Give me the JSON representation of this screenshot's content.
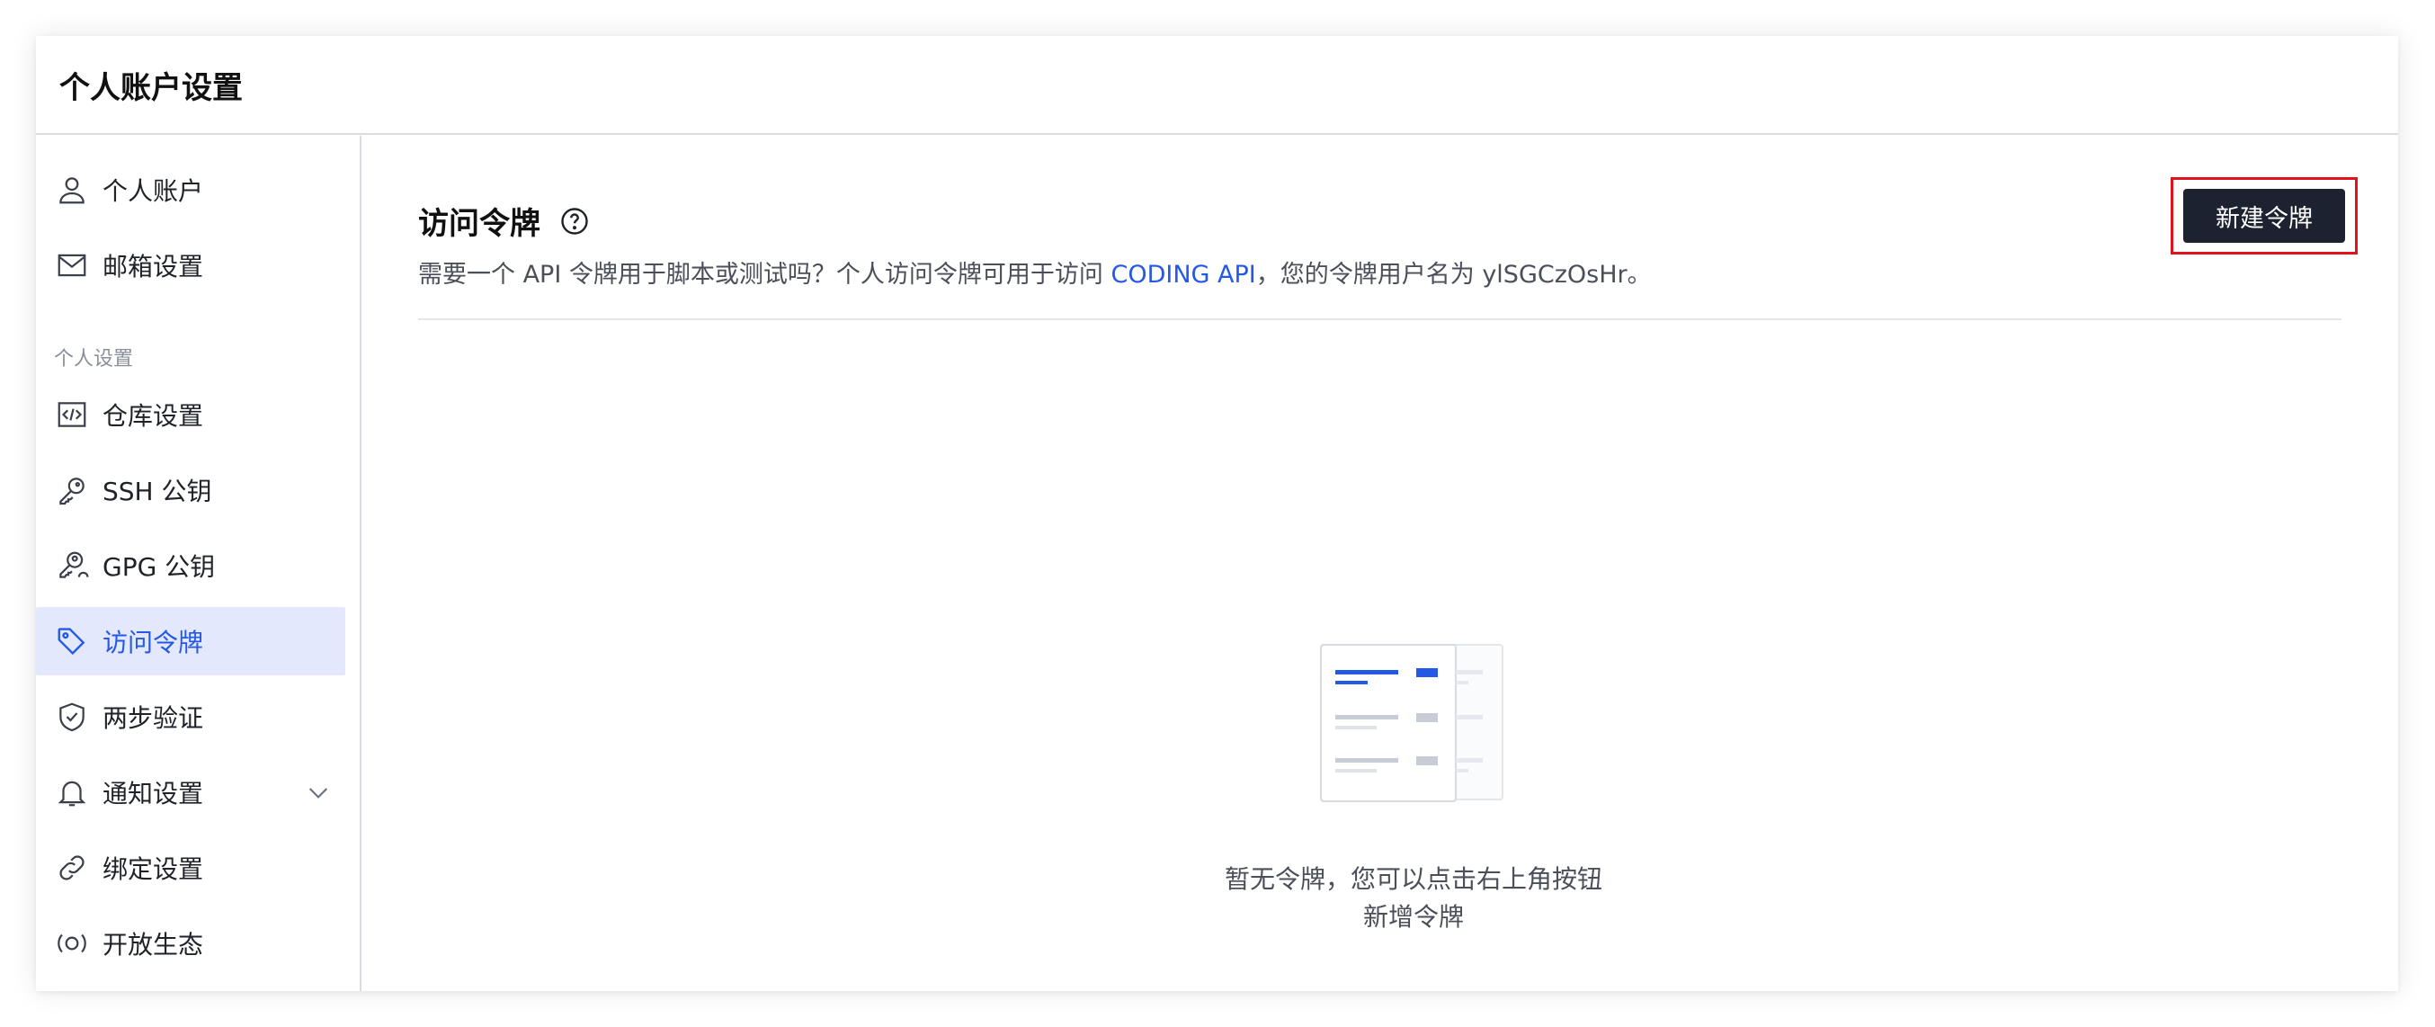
{
  "header": {
    "title": "个人账户设置"
  },
  "sidebar": {
    "items": [
      {
        "label": "个人账户",
        "icon": "user-icon"
      },
      {
        "label": "邮箱设置",
        "icon": "mail-icon"
      },
      {
        "label": "仓库设置",
        "icon": "code-icon"
      },
      {
        "label": "SSH 公钥",
        "icon": "key-icon"
      },
      {
        "label": "GPG 公钥",
        "icon": "key-user-icon"
      },
      {
        "label": "访问令牌",
        "icon": "tag-icon",
        "active": true
      },
      {
        "label": "两步验证",
        "icon": "shield-check-icon"
      },
      {
        "label": "通知设置",
        "icon": "bell-icon",
        "expandable": true
      },
      {
        "label": "绑定设置",
        "icon": "link-icon"
      },
      {
        "label": "开放生态",
        "icon": "open-ecosystem-icon"
      }
    ],
    "group_label": "个人设置"
  },
  "main": {
    "title": "访问令牌",
    "description_prefix": "需要一个 API 令牌用于脚本或测试吗？个人访问令牌可用于访问 ",
    "description_link": "CODING API",
    "description_suffix": "，您的令牌用户名为 ylSGCzOsHr。",
    "new_button_label": "新建令牌",
    "empty_line1": "暂无令牌，您可以点击右上角按钮",
    "empty_line2": "新增令牌"
  },
  "colors": {
    "accent": "#2458e6",
    "active_bg": "#e3e8fd",
    "button_bg": "#1c2230",
    "highlight_border": "#e0121a"
  }
}
